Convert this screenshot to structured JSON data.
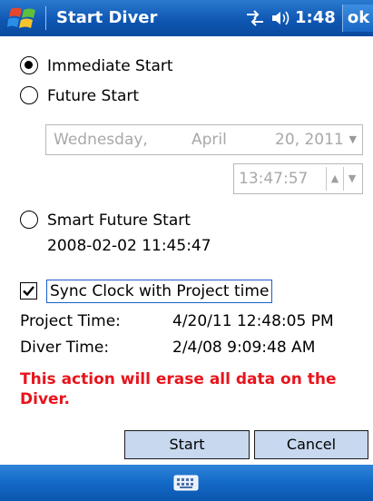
{
  "titlebar": {
    "title": "Start Diver",
    "time": "1:48",
    "ok_label": "ok",
    "start_icon": "windows-flag-icon",
    "connectivity_icon": "connectivity-icon",
    "volume_icon": "speaker-icon"
  },
  "options": {
    "immediate_label": "Immediate Start",
    "immediate_selected": true,
    "future_label": "Future Start",
    "smart_label": "Smart Future Start",
    "smart_datetime": "2008-02-02 11:45:47"
  },
  "date_picker": {
    "weekday": "Wednesday,",
    "month": "April",
    "date": "20, 2011",
    "arrow": "▼"
  },
  "time_picker": {
    "value": "13:47:57",
    "up": "▲",
    "down": "▼"
  },
  "sync": {
    "label": "Sync Clock with Project time",
    "checked": true
  },
  "info": {
    "project_label": "Project Time:",
    "project_value": "4/20/11 12:48:05 PM",
    "diver_label": "Diver Time:",
    "diver_value": "2/4/08 9:09:48 AM"
  },
  "warning": "This action will erase all data on the Diver.",
  "buttons": {
    "start": "Start",
    "cancel": "Cancel"
  },
  "bottombar": {
    "keyboard_icon": "keyboard-icon"
  },
  "colors": {
    "titlebar_blue": "#0f57b3",
    "warning_red": "#e8141c",
    "button_fill": "#c7d8ef"
  }
}
